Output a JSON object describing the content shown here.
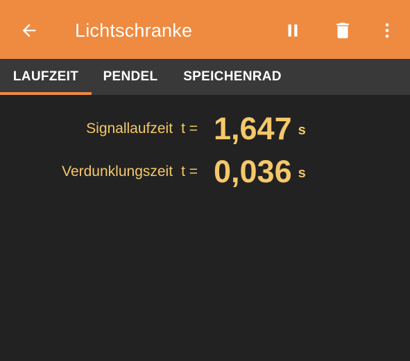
{
  "appbar": {
    "title": "Lichtschranke",
    "back_icon": "arrow-back-icon",
    "actions": [
      "pause-icon",
      "delete-icon",
      "more-vert-icon"
    ],
    "color": "#ef8a41"
  },
  "tabs": [
    {
      "label": "LAUFZEIT",
      "selected": true
    },
    {
      "label": "PENDEL",
      "selected": false
    },
    {
      "label": "SPEICHENRAD",
      "selected": false
    }
  ],
  "measurements": [
    {
      "label": "Signallaufzeit",
      "symbol": "t =",
      "value": "1,647",
      "unit": "s"
    },
    {
      "label": "Verdunklungszeit",
      "symbol": "t =",
      "value": "0,036",
      "unit": "s"
    }
  ],
  "colors": {
    "background": "#222222",
    "tabbar": "#393939",
    "accent": "#ef8a41",
    "value_text": "#f5c86a"
  }
}
